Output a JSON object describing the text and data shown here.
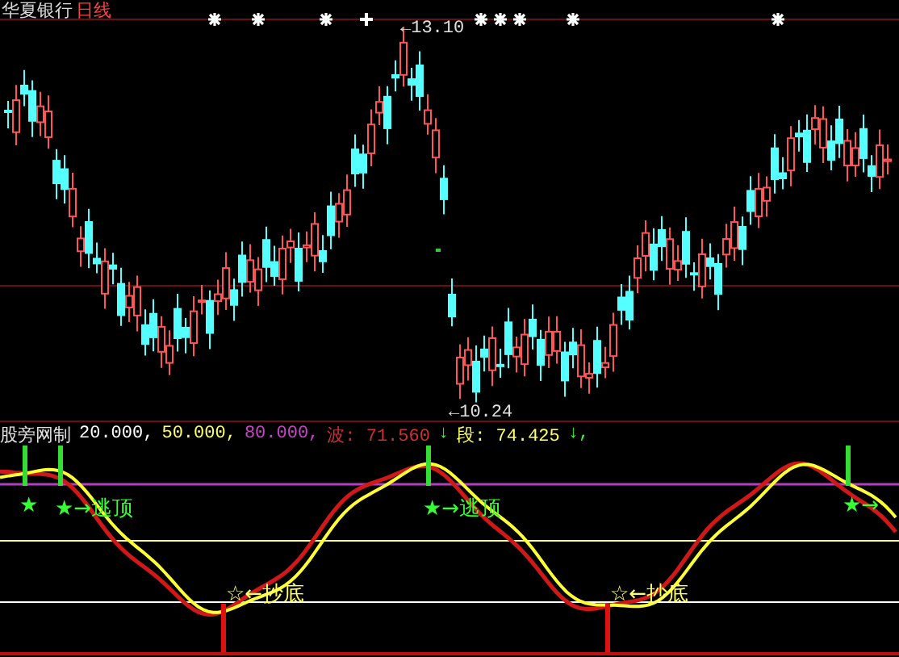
{
  "chart_header": {
    "stock_name": "华夏银行",
    "period": "日线"
  },
  "price_labels": [
    {
      "kind": "high",
      "text": "←13.10"
    },
    {
      "kind": "low",
      "text": "←10.24"
    }
  ],
  "indicator_header": [
    {
      "text": "股旁网制",
      "color": "#e0e0e0"
    },
    {
      "text": "20.000,",
      "color": "#ffffff"
    },
    {
      "text": "50.000,",
      "color": "#ffff66"
    },
    {
      "text": "80.000,",
      "color": "#cc44cc"
    },
    {
      "text": "波: 71.560",
      "color": "#d03030"
    },
    {
      "text": "↓",
      "color": "#33ff33"
    },
    {
      "text": "段: 74.425",
      "color": "#ffff66"
    },
    {
      "text": "↓,",
      "color": "#33ff33"
    }
  ],
  "signals": [
    {
      "kind": "top",
      "text": "★"
    },
    {
      "kind": "top",
      "text": "★→逃顶"
    },
    {
      "kind": "bottom",
      "text": "☆←抄底"
    },
    {
      "kind": "top",
      "text": "★→逃顶"
    },
    {
      "kind": "bottom",
      "text": "☆←抄底"
    },
    {
      "kind": "top",
      "text": "★→"
    }
  ]
}
